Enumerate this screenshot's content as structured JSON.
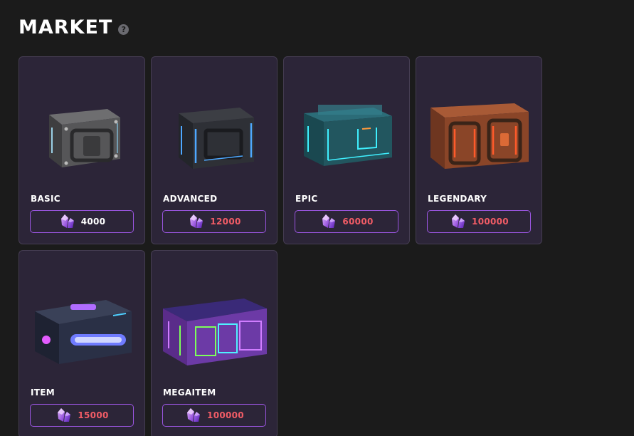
{
  "header": {
    "title": "MARKET",
    "help_icon": "question-circle-icon"
  },
  "currency_icon": "purple-crystal-icon",
  "colors": {
    "background": "#1b1b1b",
    "card": "#2c2538",
    "accent_border": "#9a55e0",
    "price_affordable": "#ffffff",
    "price_unaffordable": "#f25c66"
  },
  "cards": [
    {
      "name": "BASIC",
      "price": "4000",
      "image": "gray-metal-crate"
    },
    {
      "name": "ADVANCED",
      "price": "12000",
      "image": "dark-blue-crate"
    },
    {
      "name": "EPIC",
      "price": "60000",
      "image": "teal-crate"
    },
    {
      "name": "LEGENDARY",
      "price": "100000",
      "image": "orange-crate"
    },
    {
      "name": "ITEM",
      "price": "15000",
      "image": "blue-chest"
    },
    {
      "name": "MEGAITEM",
      "price": "100000",
      "image": "purple-chest"
    }
  ]
}
